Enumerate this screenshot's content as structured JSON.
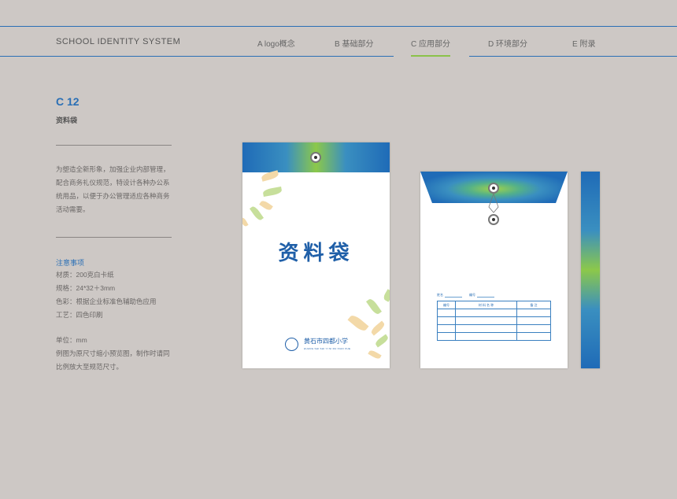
{
  "header": {
    "brand": "SCHOOL IDENTITY SYSTEM",
    "nav": [
      {
        "label": "A logo概念"
      },
      {
        "label": "B 基础部分"
      },
      {
        "label": "C 应用部分",
        "active": true
      },
      {
        "label": "D 环境部分"
      },
      {
        "label": "E 附录"
      }
    ],
    "accent_color": "#2a6fb5",
    "active_color": "#8bc24a"
  },
  "section": {
    "code": "C 12",
    "title": "资料袋",
    "description": [
      "为塑造全新形象，加强企业内部管理，",
      "配合商务礼仪规范，特设计各种办公系",
      "统用品，以便于办公管理适应各种商务",
      "活动需要。"
    ],
    "notes_title": "注意事项",
    "notes": [
      "材质：200克白卡纸",
      "规格：24*32＋3mm",
      "色彩：根据企业标准色辅助色应用",
      "工艺：四色印刷"
    ],
    "unit": "单位：mm",
    "footnote": [
      "例图为原尺寸缩小预览图，制作时请同",
      "比例放大至规范尺寸。"
    ]
  },
  "envelope_front": {
    "title": "资料袋",
    "school_name": "黄石市",
    "school_name2": "四都小学",
    "school_pinyin": "HUANG SHI SHI YI SI DU XIAO XUE"
  },
  "envelope_back": {
    "field1": "姓名",
    "field2": "编号",
    "table_headers": [
      "编号",
      "材 料 名 称",
      "备 注"
    ],
    "rows": 4
  }
}
